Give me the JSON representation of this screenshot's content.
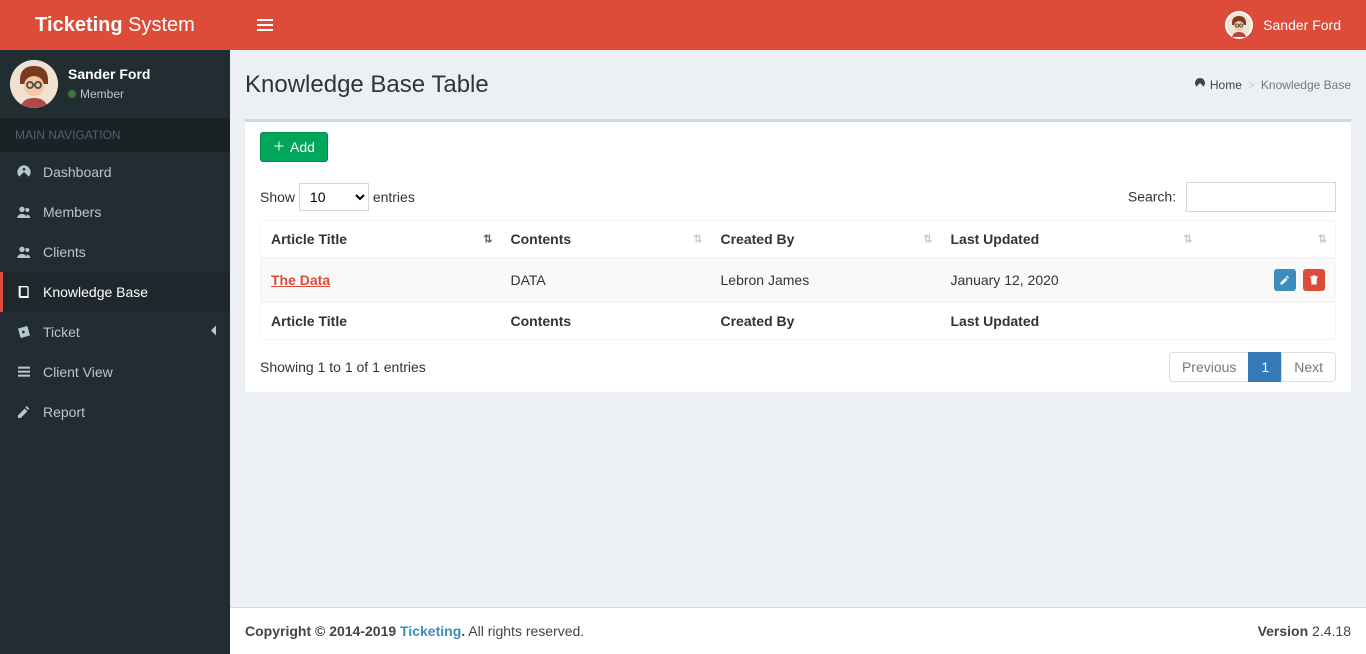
{
  "brand": {
    "bold": "Ticketing",
    "light": " System"
  },
  "header_user_name": "Sander Ford",
  "user_panel": {
    "name": "Sander Ford",
    "status": "Member"
  },
  "nav_header": "MAIN NAVIGATION",
  "sidebar": {
    "items": [
      {
        "label": "Dashboard"
      },
      {
        "label": "Members"
      },
      {
        "label": "Clients"
      },
      {
        "label": "Knowledge Base"
      },
      {
        "label": "Ticket"
      },
      {
        "label": "Client View"
      },
      {
        "label": "Report"
      }
    ]
  },
  "page": {
    "title": "Knowledge Base Table"
  },
  "breadcrumb": {
    "home": "Home",
    "active": "Knowledge Base"
  },
  "buttons": {
    "add": "Add"
  },
  "datatable": {
    "length_pre": "Show",
    "length_value": "10",
    "length_post": "entries",
    "search_label": "Search:",
    "columns": [
      "Article Title",
      "Contents",
      "Created By",
      "Last Updated",
      ""
    ],
    "footer": [
      "Article Title",
      "Contents",
      "Created By",
      "Last Updated",
      ""
    ],
    "rows": [
      {
        "title": "The Data",
        "contents": "DATA",
        "created_by": "Lebron James",
        "last_updated": "January 12, 2020"
      }
    ],
    "info": "Showing 1 to 1 of 1 entries",
    "pagination": {
      "prev": "Previous",
      "pages": [
        "1"
      ],
      "next": "Next"
    }
  },
  "footer": {
    "copyright_prefix": "Copyright © 2014-2019 ",
    "brand_link": "Ticketing",
    "rights": " All rights reserved.",
    "version_label": "Version",
    "version_value": " 2.4.18"
  }
}
